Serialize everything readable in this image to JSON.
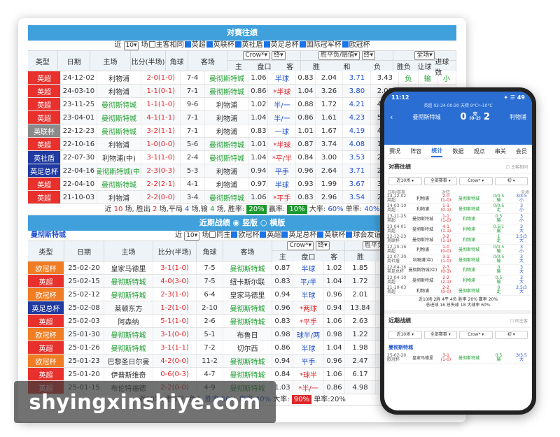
{
  "colors": {
    "header_blue": "#3fa0dc",
    "win_green": "#1e9e2f",
    "loss_red": "#e0282c",
    "phone_blue": "#2a6ed4"
  },
  "h2h": {
    "title": "对赛往绩",
    "filter": {
      "prefix": "近",
      "count": "10",
      "unit": "场",
      "options": [
        "主客相同",
        "英超",
        "英联杯",
        "英社盾",
        "英足总杯",
        "国际冠军杯",
        "欧冠杯"
      ],
      "checked": [
        false,
        true,
        true,
        true,
        true,
        true,
        true
      ]
    },
    "headers": {
      "type": "类型",
      "date": "日期",
      "home": "主场",
      "score": "比分(半场)",
      "corner": "角球",
      "away": "客场",
      "company": "Crow*",
      "term": "终",
      "hdp_group": "胜平负/赔值",
      "term2": "终",
      "result_sel": "全场",
      "sub_main": "主",
      "sub_line": "盘口",
      "sub_away": "客",
      "sub_win": "胜",
      "sub_draw": "和",
      "sub_loss": "负",
      "wl": "胜负",
      "hdp": "让球",
      "ou": "进球数"
    },
    "rows": [
      {
        "league": "英超",
        "lc": "#e8312d",
        "date": "24-12-02",
        "home": "利物浦",
        "hc": "",
        "score": "2-0(1-0)",
        "corner": "7-4",
        "away": "曼彻斯特城",
        "ac": "g",
        "m": "1.06",
        "line": "半球",
        "lc2": "b",
        "a": "0.83",
        "w": "2.04",
        "d": "3.71",
        "l": "3.43",
        "wl": "负",
        "wlc": "g",
        "hd": "输",
        "hdc": "g",
        "ou": "小",
        "ouc": "g"
      },
      {
        "league": "英超",
        "lc": "#e8312d",
        "date": "24-03-10",
        "home": "利物浦",
        "hc": "",
        "score": "1-1(0-1)",
        "corner": "7-1",
        "away": "曼彻斯特城",
        "ac": "g",
        "m": "0.86",
        "line": "*半球",
        "lc2": "r",
        "a": "1.04",
        "w": "3.26",
        "d": "3.80",
        "l": "2.08",
        "wl": "",
        "wlc": "",
        "hd": "",
        "hdc": "",
        "ou": "",
        "ouc": ""
      },
      {
        "league": "英超",
        "lc": "#e8312d",
        "date": "23-11-25",
        "home": "曼彻斯特城",
        "hc": "g",
        "score": "1-1(1-0)",
        "corner": "9-6",
        "away": "利物浦",
        "ac": "",
        "m": "1.02",
        "line": "半/一",
        "lc2": "b",
        "a": "0.88",
        "w": "1.72",
        "d": "4.21",
        "l": "4.52",
        "wl": "",
        "wlc": "",
        "hd": "",
        "hdc": "",
        "ou": "",
        "ouc": ""
      },
      {
        "league": "英超",
        "lc": "#e8312d",
        "date": "23-04-01",
        "home": "曼彻斯特城",
        "hc": "g",
        "score": "4-1(1-1)",
        "corner": "7-1",
        "away": "利物浦",
        "ac": "",
        "m": "1.04",
        "line": "半/一",
        "lc2": "b",
        "a": "0.86",
        "w": "1.61",
        "d": "4.23",
        "l": "5.33",
        "wl": "",
        "wlc": "",
        "hd": "",
        "hdc": "",
        "ou": "",
        "ouc": ""
      },
      {
        "league": "英联杯",
        "lc": "#8a8a8a",
        "date": "22-12-23",
        "home": "曼彻斯特城",
        "hc": "g",
        "score": "3-2(1-1)",
        "corner": "7-1",
        "away": "利物浦",
        "ac": "",
        "m": "0.83",
        "line": "一球",
        "lc2": "b",
        "a": "1.01",
        "w": "1.67",
        "d": "4.19",
        "l": "4.64",
        "wl": "",
        "wlc": "",
        "hd": "",
        "hdc": "",
        "ou": "",
        "ouc": ""
      },
      {
        "league": "英超",
        "lc": "#e8312d",
        "date": "22-10-16",
        "home": "利物浦",
        "hc": "",
        "score": "1-0(0-0)",
        "corner": "5-6",
        "away": "曼彻斯特城",
        "ac": "g",
        "m": "1.01",
        "line": "*半球",
        "lc2": "r",
        "a": "0.87",
        "w": "3.74",
        "d": "4.08",
        "l": "1.88",
        "wl": "",
        "wlc": "",
        "hd": "",
        "hdc": "",
        "ou": "",
        "ouc": ""
      },
      {
        "league": "英社盾",
        "lc": "#1f3aa0",
        "date": "22-07-30",
        "home": "利物浦(中)",
        "hc": "",
        "score": "3-1(1-0)",
        "corner": "2-4",
        "away": "曼彻斯特城",
        "ac": "g",
        "m": "1.04",
        "line": "*平/半",
        "lc2": "r",
        "a": "0.84",
        "w": "3.00",
        "d": "3.53",
        "l": "2.33",
        "wl": "",
        "wlc": "",
        "hd": "",
        "hdc": "",
        "ou": "",
        "ouc": ""
      },
      {
        "league": "英足总杯",
        "lc": "#1f3aa0",
        "date": "22-04-16",
        "home": "曼彻斯特城(中)",
        "hc": "g",
        "score": "2-3(0-3)",
        "corner": "5-3",
        "away": "利物浦",
        "ac": "",
        "m": "0.94",
        "line": "平手",
        "lc2": "b",
        "a": "0.96",
        "w": "2.64",
        "d": "3.71",
        "l": "2.55",
        "wl": "",
        "wlc": "",
        "hd": "",
        "hdc": "",
        "ou": "",
        "ouc": ""
      },
      {
        "league": "英超",
        "lc": "#e8312d",
        "date": "22-04-10",
        "home": "曼彻斯特城",
        "hc": "g",
        "score": "2-2(2-1)",
        "corner": "4-1",
        "away": "利物浦",
        "ac": "",
        "m": "0.97",
        "line": "半球",
        "lc2": "b",
        "a": "0.93",
        "w": "1.99",
        "d": "3.67",
        "l": "3.60",
        "wl": "",
        "wlc": "",
        "hd": "",
        "hdc": "",
        "ou": "",
        "ouc": ""
      },
      {
        "league": "英超",
        "lc": "#e8312d",
        "date": "21-10-03",
        "home": "利物浦",
        "hc": "",
        "score": "2-2(0-0)",
        "corner": "3-4",
        "away": "曼彻斯特城",
        "ac": "g",
        "m": "1.06",
        "line": "*平手",
        "lc2": "r",
        "a": "0.83",
        "w": "2.96",
        "d": "3.54",
        "l": "2.33",
        "wl": "",
        "wlc": "",
        "hd": "",
        "hdc": "",
        "ou": "",
        "ouc": ""
      }
    ],
    "summary": {
      "t1": "近",
      "n": "10",
      "t2": "场, 胜出",
      "w": "2",
      "t3": "场,平局",
      "d": "4",
      "t4": "场,输",
      "l": "4",
      "t5": "场, 胜率:",
      "wr": "20%",
      "t6": "赢率:",
      "hr": "10%",
      "t7": "大率:",
      "br": "60%",
      "t8": "单率:",
      "sr": "40%"
    }
  },
  "recent": {
    "title": "近期战绩",
    "tab1": "竖版",
    "tab2": "横版",
    "team": "曼彻斯特城",
    "filter": {
      "prefix": "近",
      "count": "10",
      "unit": "场",
      "options": [
        "同主",
        "欧冠杯",
        "英超",
        "英足总杯",
        "英联杯",
        "球会友谊"
      ],
      "checked": [
        false,
        true,
        true,
        true,
        true,
        true
      ]
    },
    "rows": [
      {
        "league": "欧冠杯",
        "lc": "#f07c23",
        "date": "25-02-20",
        "home": "皇家马德里",
        "hc": "",
        "score": "3-1(1-0)",
        "corner": "7-5",
        "away": "曼彻斯特城",
        "ac": "g",
        "m": "0.87",
        "line": "半球",
        "lc2": "b",
        "a": "1.02",
        "w": "1.85",
        "d": "4.23",
        "l": "3.6"
      },
      {
        "league": "英超",
        "lc": "#e8312d",
        "date": "25-02-15",
        "home": "曼彻斯特城",
        "hc": "g",
        "score": "4-0(3-0)",
        "corner": "7-5",
        "away": "纽卡斯尔联",
        "ac": "",
        "m": "0.83",
        "line": "平/半",
        "lc2": "b",
        "a": "1.04",
        "w": "1.72",
        "d": "4.23",
        "l": "3.9"
      },
      {
        "league": "欧冠杯",
        "lc": "#f07c23",
        "date": "25-02-12",
        "home": "曼彻斯特城",
        "hc": "g",
        "score": "2-3(1-0)",
        "corner": "6-4",
        "away": "皇家马德里",
        "ac": "",
        "m": "0.94",
        "line": "半球",
        "lc2": "b",
        "a": "0.96",
        "w": "2.01",
        "d": "3.92",
        "l": "3.3"
      },
      {
        "league": "英足总杯",
        "lc": "#1f3aa0",
        "date": "25-02-08",
        "home": "莱顿东方",
        "hc": "",
        "score": "1-2(1-0)",
        "corner": "2-10",
        "away": "曼彻斯特城",
        "ac": "g",
        "m": "0.96",
        "line": "*两球",
        "lc2": "r",
        "a": "0.94",
        "w": "13.84",
        "d": "7.73",
        "l": "1.1"
      },
      {
        "league": "英超",
        "lc": "#e8312d",
        "date": "25-02-03",
        "home": "阿森纳",
        "hc": "",
        "score": "5-1(1-0)",
        "corner": "2-6",
        "away": "曼彻斯特城",
        "ac": "g",
        "m": "0.83",
        "line": "*平手",
        "lc2": "r",
        "a": "1.06",
        "w": "2.63",
        "d": "3.43",
        "l": "2.7"
      },
      {
        "league": "欧冠杯",
        "lc": "#f07c23",
        "date": "25-01-30",
        "home": "曼彻斯特城",
        "hc": "g",
        "score": "3-1(0-0)",
        "corner": "5-1",
        "away": "布鲁日",
        "ac": "",
        "m": "0.98",
        "line": "球半/两",
        "lc2": "b",
        "a": "0.98",
        "w": "1.22",
        "d": "6.89",
        "l": "11.6"
      },
      {
        "league": "英超",
        "lc": "#e8312d",
        "date": "25-01-26",
        "home": "曼彻斯特城",
        "hc": "g",
        "score": "3-1(1-1)",
        "corner": "7-2",
        "away": "切尔西",
        "ac": "",
        "m": "0.86",
        "line": "半球",
        "lc2": "b",
        "a": "1.04",
        "w": "1.98",
        "d": "4.23",
        "l": "3.3"
      },
      {
        "league": "欧冠杯",
        "lc": "#f07c23",
        "date": "25-01-23",
        "home": "巴黎圣日尔曼",
        "hc": "",
        "score": "4-2(0-0)",
        "corner": "11-2",
        "away": "曼彻斯特城",
        "ac": "g",
        "m": "0.94",
        "line": "平手",
        "lc2": "b",
        "a": "0.96",
        "w": "2.47",
        "d": "4.13",
        "l": "2.6"
      },
      {
        "league": "英超",
        "lc": "#e8312d",
        "date": "25-01-20",
        "home": "伊普斯维奇",
        "hc": "",
        "score": "0-6(0-3)",
        "corner": "4-7",
        "away": "曼彻斯特城",
        "ac": "g",
        "m": "0.84",
        "line": "*球半",
        "lc2": "r",
        "a": "1.06",
        "w": "6.17",
        "d": "5.01",
        "l": "1.4"
      },
      {
        "league": "英超",
        "lc": "#e8312d",
        "date": "25-01-15",
        "home": "布伦特福德",
        "hc": "",
        "score": "2-2(0-0)",
        "corner": "4-9",
        "away": "曼彻斯特城",
        "ac": "g",
        "m": "1.03",
        "line": "*半/一",
        "lc2": "r",
        "a": "0.86",
        "w": "4.98",
        "d": "4.46",
        "l": "1.6"
      }
    ],
    "summary": {
      "t1": "近10场,",
      "wins": "胜5平1负4,",
      "wr": "胜率:50%",
      "t2": "赢率:40%",
      "t3": "大率:",
      "br": "90%",
      "t4": "单率:20%"
    }
  },
  "watermark": "shyingxinshiye.com",
  "phone": {
    "status": {
      "time": "11:12",
      "right": "✦ ☰ 49"
    },
    "info": "英超 02-24 00:30 天晴 9°C～10°C",
    "home": "曼彻斯特城",
    "away": "利物浦",
    "hs": "0",
    "as": "2",
    "status_word": "完",
    "half": "(0-2)",
    "tabs": [
      "赛况",
      "阵容",
      "统计",
      "数据",
      "观点",
      "串关",
      "会员"
    ],
    "active_tab": 2,
    "sec1": "对赛往绩",
    "sec1_chk": "主客相同",
    "filt1": [
      "近10场",
      "全部赛事",
      "Crow*",
      "初"
    ],
    "cols": [
      "日期/赛事",
      "",
      "对阵",
      "",
      "全场"
    ],
    "rows": [
      {
        "d": "24-12-02",
        "l": "英超",
        "h": "利物浦",
        "s1": "2-0",
        "s2": "(1-0)",
        "a": "曼彻斯特城",
        "o1": "0/0.5",
        "o1b": "输",
        "o2": "3/3.5",
        "o2b": "小"
      },
      {
        "d": "24-03-10",
        "l": "英超",
        "h": "利物浦",
        "s1": "1-1",
        "s2": "(0-1)",
        "a": "曼彻斯特城",
        "o1": "0/0.5",
        "o1b": "走",
        "o2": "3",
        "o2b": "小"
      },
      {
        "d": "23-11-25",
        "l": "英超",
        "h": "曼彻斯特城",
        "s1": "1-1",
        "s2": "(1-0)",
        "a": "利物浦",
        "o1": "0.5",
        "o1b": "输",
        "o2": "3",
        "o2b": "小"
      },
      {
        "d": "23-04-01",
        "l": "英超",
        "h": "曼彻斯特城",
        "s1": "4-1",
        "s2": "(1-1)",
        "a": "利物浦",
        "o1": "0.5/1",
        "o1b": "赢",
        "o2": "3",
        "o2b": "大"
      },
      {
        "d": "22-12-23",
        "l": "英联杯",
        "h": "曼彻斯特城",
        "s1": "3-2",
        "s2": "(1-1)",
        "a": "利物浦",
        "o1": "1",
        "o1b": "走",
        "o2": "2.5/3",
        "o2b": "大"
      },
      {
        "d": "22-10-16",
        "l": "英超",
        "h": "利物浦",
        "s1": "1-0",
        "s2": "(0-0)",
        "a": "曼彻斯特城",
        "o1": "0/0.5",
        "o1b": "输",
        "o2": "3",
        "o2b": "小"
      },
      {
        "d": "22-07-30",
        "l": "英社盾",
        "h": "利物浦(中)",
        "s1": "3-1",
        "s2": "(1-0)",
        "a": "曼彻斯特城",
        "o1": "0/0.5",
        "o1b": "输",
        "o2": "3",
        "o2b": "大"
      },
      {
        "d": "22-04-16",
        "l": "英足总杯",
        "h": "曼彻斯特城(中)",
        "s1": "2-3",
        "s2": "(0-3)",
        "a": "利物浦",
        "o1": "0",
        "o1b": "输",
        "o2": "3",
        "o2b": "大"
      },
      {
        "d": "22-04-10",
        "l": "英超",
        "h": "曼彻斯特城",
        "s1": "2-2",
        "s2": "(2-1)",
        "a": "利物浦",
        "o1": "0.5",
        "o1b": "输",
        "o2": "3",
        "o2b": "大"
      },
      {
        "d": "21-10-03",
        "l": "英超",
        "h": "利物浦",
        "s1": "2-2",
        "s2": "(0-0)",
        "a": "曼彻斯特城",
        "o1": "0",
        "o1b": "走",
        "o2": "2.5/3",
        "o2b": "大"
      }
    ],
    "sum1a": "近10场 2胜 4平 4负 胜率 20% 赢率 20%",
    "sum1b": "总进球 16 总失球 18 大球率 60%",
    "sec2": "近期战绩",
    "sec2_chk": "同主客",
    "filt2": [
      "近10场",
      "全部赛事",
      "Crow*",
      "初"
    ],
    "team": "曼彻斯特城",
    "row2": {
      "d": "25-02-20",
      "l": "欧冠杯",
      "h": "皇家马德里",
      "s1": "3-1",
      "s2": "(1-0)",
      "a": "曼彻斯特城",
      "o1": "0.5",
      "o1b": "输",
      "o2": "3/3.5",
      "o2b": "大"
    }
  }
}
